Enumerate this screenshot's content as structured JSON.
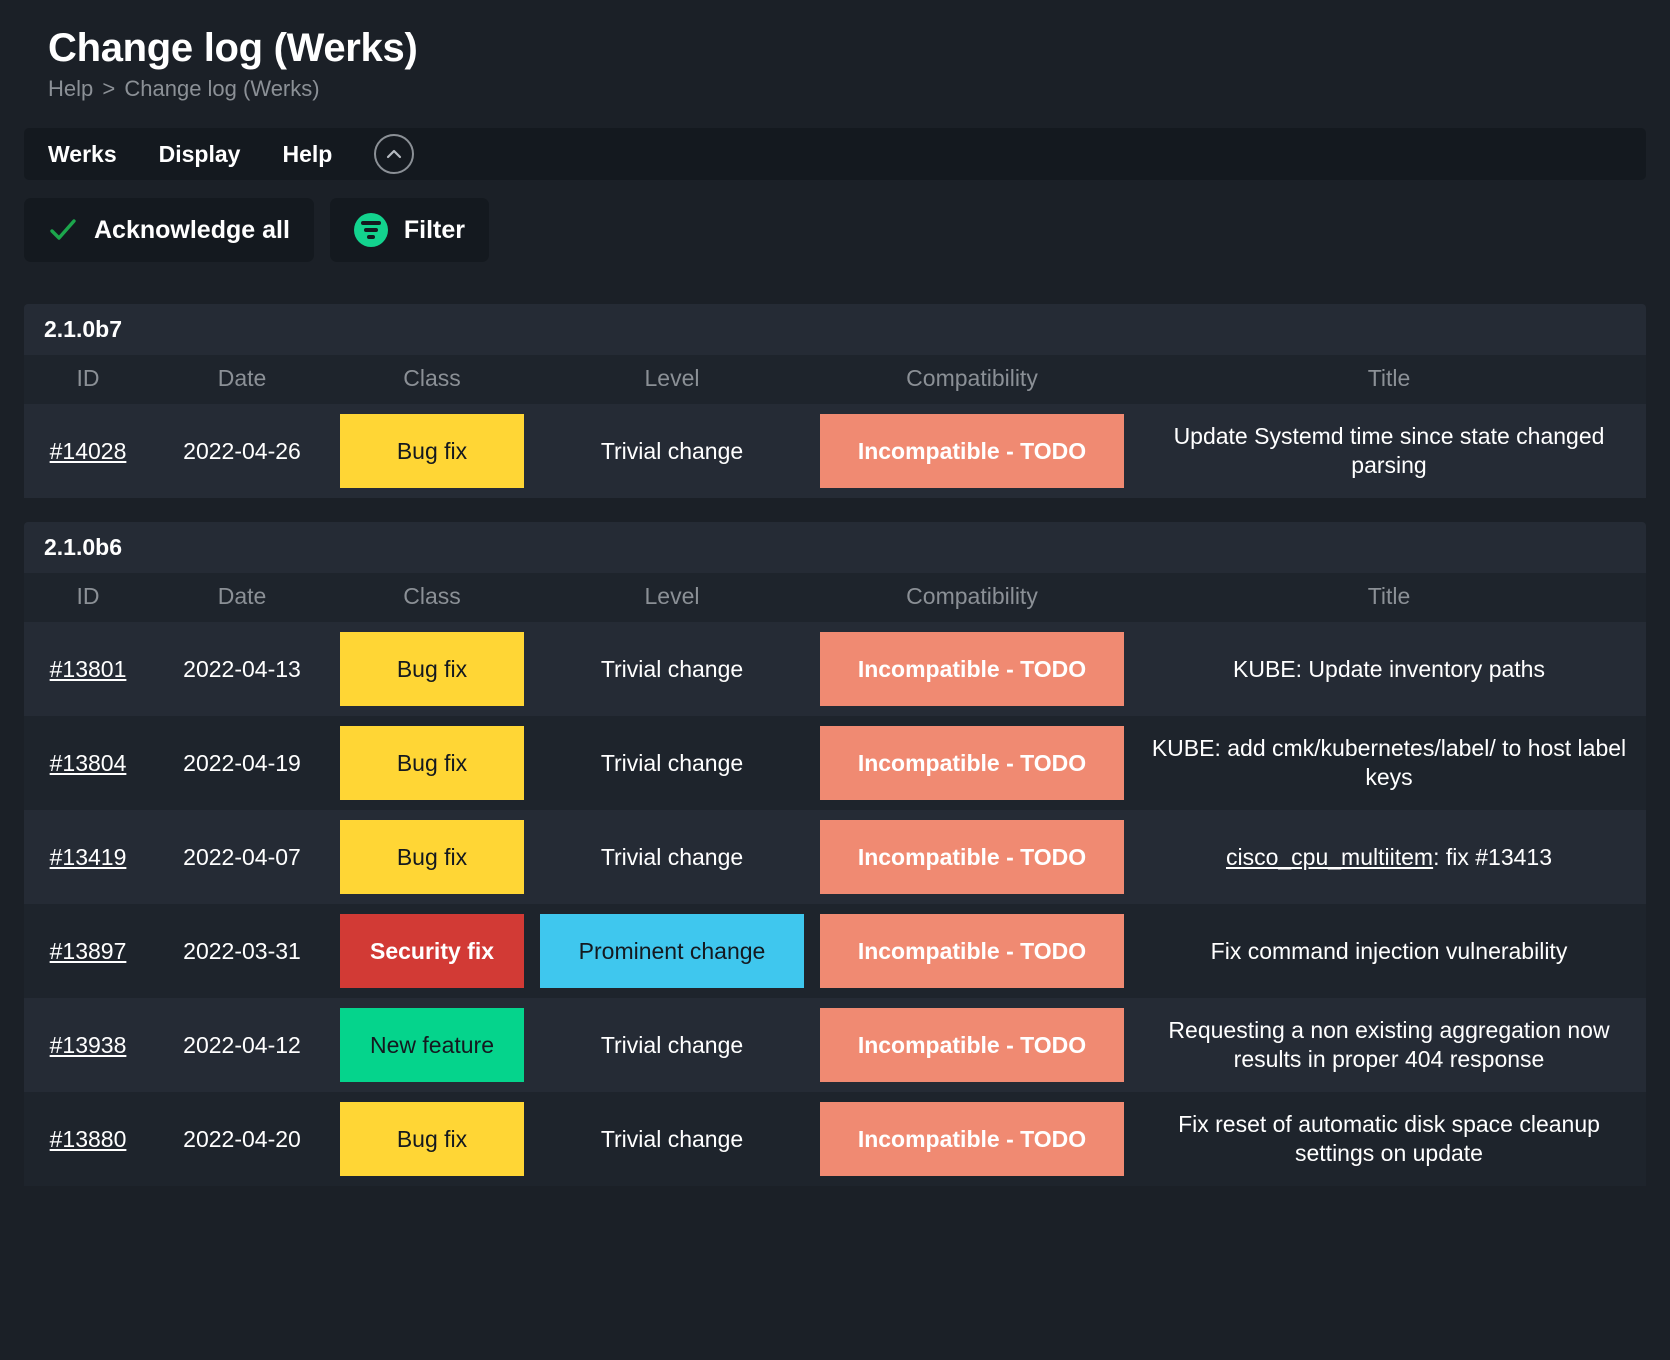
{
  "header": {
    "title": "Change log (Werks)",
    "breadcrumb": {
      "root": "Help",
      "separator": ">",
      "current": "Change log (Werks)"
    }
  },
  "menubar": {
    "items": [
      {
        "label": "Werks"
      },
      {
        "label": "Display"
      },
      {
        "label": "Help"
      }
    ],
    "collapse_icon": "chevron-up-circle-icon"
  },
  "toolbar": {
    "buttons": [
      {
        "label": "Acknowledge all",
        "icon": "check-icon",
        "accent": "#1ca64c"
      },
      {
        "label": "Filter",
        "icon": "filter-icon",
        "accent": "#13d38e"
      }
    ]
  },
  "colors": {
    "page_bg": "#1b2027",
    "panel_bg": "#14191f",
    "row_light": "#252b35",
    "row_dark": "#1e242c",
    "muted_text": "#8b9096",
    "bug_fix": "#ffd635",
    "security_fix": "#d23a35",
    "new_feature": "#05d48c",
    "prominent_change": "#3fc7ee",
    "incompatible": "#f08a72"
  },
  "columns": [
    "ID",
    "Date",
    "Class",
    "Level",
    "Compatibility",
    "Title"
  ],
  "tables": [
    {
      "version": "2.1.0b7",
      "rows": [
        {
          "id": "#14028",
          "date": "2022-04-26",
          "class": "Bug fix",
          "class_style": "t-bugfix",
          "level": "Trivial change",
          "level_style": "plain",
          "compatibility": "Incompatible - TODO",
          "compat_style": "t-incompat",
          "title": "Update Systemd time since state changed parsing",
          "title_link": null,
          "title_rest": null
        }
      ]
    },
    {
      "version": "2.1.0b6",
      "rows": [
        {
          "id": "#13801",
          "date": "2022-04-13",
          "class": "Bug fix",
          "class_style": "t-bugfix",
          "level": "Trivial change",
          "level_style": "plain",
          "compatibility": "Incompatible - TODO",
          "compat_style": "t-incompat",
          "title": "KUBE: Update inventory paths",
          "title_link": null,
          "title_rest": null
        },
        {
          "id": "#13804",
          "date": "2022-04-19",
          "class": "Bug fix",
          "class_style": "t-bugfix",
          "level": "Trivial change",
          "level_style": "plain",
          "compatibility": "Incompatible - TODO",
          "compat_style": "t-incompat",
          "title": "KUBE: add cmk/kubernetes/label/ to host label keys",
          "title_link": null,
          "title_rest": null
        },
        {
          "id": "#13419",
          "date": "2022-04-07",
          "class": "Bug fix",
          "class_style": "t-bugfix",
          "level": "Trivial change",
          "level_style": "plain",
          "compatibility": "Incompatible - TODO",
          "compat_style": "t-incompat",
          "title": null,
          "title_link": "cisco_cpu_multiitem",
          "title_rest": ": fix #13413"
        },
        {
          "id": "#13897",
          "date": "2022-03-31",
          "class": "Security fix",
          "class_style": "t-securityfix",
          "level": "Prominent change",
          "level_style": "t-prominent",
          "compatibility": "Incompatible - TODO",
          "compat_style": "t-incompat",
          "title": "Fix command injection vulnerability",
          "title_link": null,
          "title_rest": null
        },
        {
          "id": "#13938",
          "date": "2022-04-12",
          "class": "New feature",
          "class_style": "t-newfeature",
          "level": "Trivial change",
          "level_style": "plain",
          "compatibility": "Incompatible - TODO",
          "compat_style": "t-incompat",
          "title": "Requesting a non existing aggregation now results in proper 404 response",
          "title_link": null,
          "title_rest": null
        },
        {
          "id": "#13880",
          "date": "2022-04-20",
          "class": "Bug fix",
          "class_style": "t-bugfix",
          "level": "Trivial change",
          "level_style": "plain",
          "compatibility": "Incompatible - TODO",
          "compat_style": "t-incompat",
          "title": "Fix reset of automatic disk space cleanup settings on update",
          "title_link": null,
          "title_rest": null
        }
      ]
    }
  ]
}
